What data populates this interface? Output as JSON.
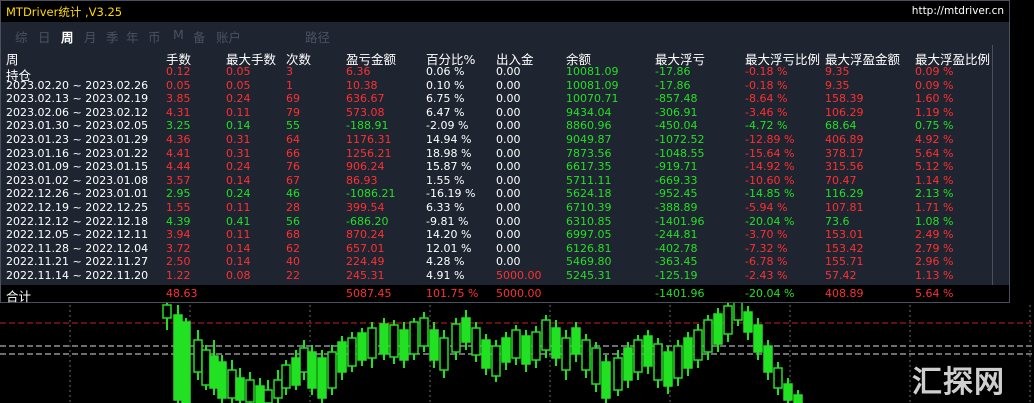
{
  "window": {
    "title": "MTDriver统计 ,V3.25",
    "url": "http://mtdriver.cn"
  },
  "tabs": [
    {
      "label": "综",
      "active": false
    },
    {
      "label": "日",
      "active": false
    },
    {
      "label": "周",
      "active": true
    },
    {
      "label": "月",
      "active": false
    },
    {
      "label": "季",
      "active": false
    },
    {
      "label": "年",
      "active": false
    },
    {
      "label": "币",
      "active": false
    },
    {
      "label": "M",
      "active": false
    },
    {
      "label": "备",
      "active": false
    },
    {
      "label": "账户",
      "active": false
    },
    {
      "label": "路径",
      "active": false
    }
  ],
  "table": {
    "columns": [
      "周",
      "手数",
      "最大手数",
      "次数",
      "盈亏金额",
      "百分比%",
      "出入金",
      "余额",
      "最大浮亏",
      "最大浮亏比例",
      "最大浮盈金额",
      "最大浮盈比例"
    ],
    "rows": [
      {
        "label": "持仓",
        "color": "red",
        "values": [
          "0.12",
          "0.05",
          "3",
          "6.36",
          "0.06 %",
          "0.00",
          "10081.09",
          "-17.86",
          "-0.18 %",
          "9.35",
          "0.09 %"
        ]
      },
      {
        "label": "2023.02.20 ~ 2023.02.26",
        "color": "red",
        "values": [
          "0.05",
          "0.05",
          "1",
          "10.38",
          "0.10 %",
          "0.00",
          "10081.09",
          "-17.86",
          "-0.18 %",
          "9.35",
          "0.09 %"
        ]
      },
      {
        "label": "2023.02.13 ~ 2023.02.19",
        "color": "red",
        "values": [
          "3.85",
          "0.24",
          "69",
          "636.67",
          "6.75 %",
          "0.00",
          "10070.71",
          "-857.48",
          "-8.64 %",
          "158.39",
          "1.60 %"
        ]
      },
      {
        "label": "2023.02.06 ~ 2023.02.12",
        "color": "red",
        "values": [
          "4.31",
          "0.11",
          "79",
          "573.08",
          "6.47 %",
          "0.00",
          "9434.04",
          "-306.91",
          "-3.46 %",
          "106.29",
          "1.19 %"
        ]
      },
      {
        "label": "2023.01.30 ~ 2023.02.05",
        "color": "green",
        "values": [
          "3.25",
          "0.14",
          "55",
          "-188.91",
          "-2.09 %",
          "0.00",
          "8860.96",
          "-450.04",
          "-4.72 %",
          "68.64",
          "0.75 %"
        ]
      },
      {
        "label": "2023.01.23 ~ 2023.01.29",
        "color": "red",
        "values": [
          "4.36",
          "0.31",
          "64",
          "1176.31",
          "14.94 %",
          "0.00",
          "9049.87",
          "-1072.52",
          "-12.89 %",
          "406.89",
          "4.92 %"
        ]
      },
      {
        "label": "2023.01.16 ~ 2023.01.22",
        "color": "red",
        "values": [
          "4.41",
          "0.31",
          "66",
          "1256.21",
          "18.98 %",
          "0.00",
          "7873.56",
          "-1048.55",
          "-15.64 %",
          "378.17",
          "5.64 %"
        ]
      },
      {
        "label": "2023.01.09 ~ 2023.01.15",
        "color": "red",
        "values": [
          "4.44",
          "0.24",
          "76",
          "906.24",
          "15.87 %",
          "0.00",
          "6617.35",
          "-919.71",
          "-14.92 %",
          "315.56",
          "5.12 %"
        ]
      },
      {
        "label": "2023.01.02 ~ 2023.01.08",
        "color": "red",
        "values": [
          "3.57",
          "0.14",
          "67",
          "86.93",
          "1.55 %",
          "0.00",
          "5711.11",
          "-669.33",
          "-10.60 %",
          "70.47",
          "1.14 %"
        ]
      },
      {
        "label": "2022.12.26 ~ 2023.01.01",
        "color": "green",
        "values": [
          "2.95",
          "0.24",
          "46",
          "-1086.21",
          "-16.19 %",
          "0.00",
          "5624.18",
          "-952.45",
          "-14.85 %",
          "116.29",
          "2.13 %"
        ]
      },
      {
        "label": "2022.12.19 ~ 2022.12.25",
        "color": "red",
        "values": [
          "1.55",
          "0.11",
          "28",
          "399.54",
          "6.33 %",
          "0.00",
          "6710.39",
          "-388.89",
          "-5.94 %",
          "107.81",
          "1.71 %"
        ]
      },
      {
        "label": "2022.12.12 ~ 2022.12.18",
        "color": "green",
        "values": [
          "4.39",
          "0.41",
          "56",
          "-686.20",
          "-9.81 %",
          "0.00",
          "6310.85",
          "-1401.96",
          "-20.04 %",
          "73.6",
          "1.08 %"
        ]
      },
      {
        "label": "2022.12.05 ~ 2022.12.11",
        "color": "red",
        "values": [
          "3.94",
          "0.11",
          "68",
          "870.24",
          "14.20 %",
          "0.00",
          "6997.05",
          "-244.81",
          "-3.70 %",
          "153.01",
          "2.49 %"
        ]
      },
      {
        "label": "2022.11.28 ~ 2022.12.04",
        "color": "red",
        "values": [
          "3.72",
          "0.14",
          "62",
          "657.01",
          "12.01 %",
          "0.00",
          "6126.81",
          "-402.78",
          "-7.32 %",
          "153.42",
          "2.79 %"
        ]
      },
      {
        "label": "2022.11.21 ~ 2022.11.27",
        "color": "red",
        "values": [
          "2.50",
          "0.14",
          "40",
          "224.49",
          "4.28 %",
          "0.00",
          "5469.80",
          "-363.45",
          "-6.78 %",
          "155.71",
          "2.96 %"
        ]
      },
      {
        "label": "2022.11.14 ~ 2022.11.20",
        "color": "red",
        "values": [
          "1.22",
          "0.08",
          "22",
          "245.31",
          "4.91 %",
          "5000.00",
          "5245.31",
          "-125.19",
          "-2.43 %",
          "57.42",
          "1.13 %"
        ]
      }
    ],
    "total": {
      "label": "合计",
      "values": [
        "48.63",
        "",
        "",
        "5087.45",
        "101.75 %",
        "5000.00",
        "",
        "-1401.96",
        "-20.04 %",
        "408.89",
        "5.64 %"
      ]
    }
  },
  "watermark": "汇探网",
  "colors": {
    "positive": "#ff3030",
    "negative": "#23e023",
    "neutral": "#ffffff",
    "title": "#ffd800",
    "panel": "#1e2430",
    "candle": "#22e022"
  }
}
